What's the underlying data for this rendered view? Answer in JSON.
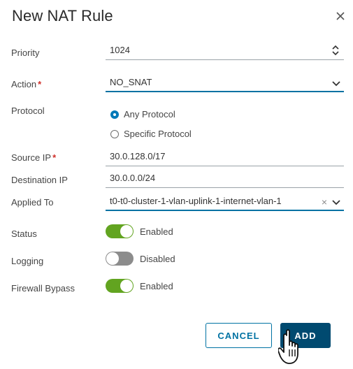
{
  "dialog": {
    "title": "New NAT Rule",
    "close_icon": "close-icon"
  },
  "fields": {
    "priority": {
      "label": "Priority",
      "value": "1024"
    },
    "action": {
      "label": "Action",
      "required": "*",
      "value": "NO_SNAT"
    },
    "protocol": {
      "label": "Protocol",
      "options": [
        "Any Protocol",
        "Specific Protocol"
      ],
      "selected": "Any Protocol"
    },
    "source_ip": {
      "label": "Source IP",
      "required": "*",
      "value": "30.0.128.0/17"
    },
    "destination_ip": {
      "label": "Destination IP",
      "value": "30.0.0.0/24"
    },
    "applied_to": {
      "label": "Applied To",
      "value": "t0-t0-cluster-1-vlan-uplink-1-internet-vlan-1",
      "clear": "×"
    },
    "status": {
      "label": "Status",
      "state": "Enabled"
    },
    "logging": {
      "label": "Logging",
      "state": "Disabled"
    },
    "firewall_bypass": {
      "label": "Firewall Bypass",
      "state": "Enabled"
    }
  },
  "buttons": {
    "cancel": "CANCEL",
    "add": "ADD"
  },
  "colors": {
    "accent": "#0072a3",
    "primary_button": "#004a70",
    "toggle_on": "#62a420",
    "toggle_off": "#8c8c8c",
    "required": "#d0302a"
  }
}
